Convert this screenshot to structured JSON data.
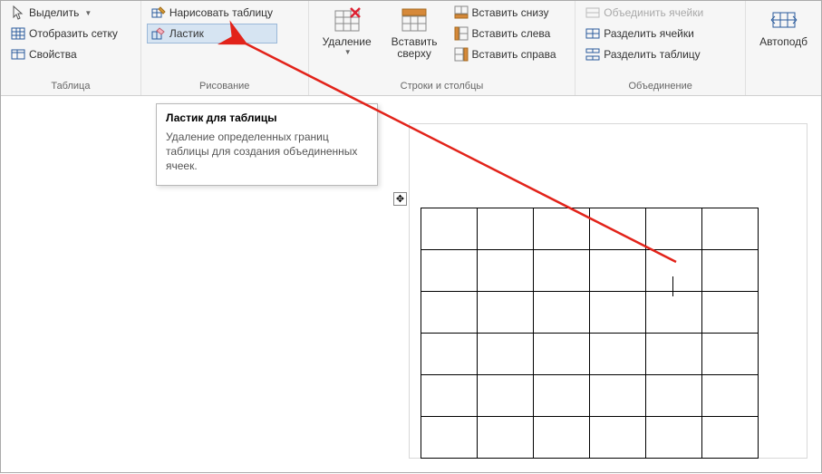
{
  "ribbon": {
    "table_group": {
      "label": "Таблица",
      "select": "Выделить",
      "showgrid": "Отобразить сетку",
      "properties": "Свойства"
    },
    "draw_group": {
      "label": "Рисование",
      "draw": "Нарисовать таблицу",
      "eraser": "Ластик"
    },
    "delete_group": {
      "delete": "Удаление"
    },
    "rows_group": {
      "label": "Строки и столбцы",
      "insert_top": "Вставить\nсверху",
      "insert_below": "Вставить снизу",
      "insert_left": "Вставить слева",
      "insert_right": "Вставить справа"
    },
    "merge_group": {
      "label": "Объединение",
      "merge": "Объединить ячейки",
      "split_cells": "Разделить ячейки",
      "split_table": "Разделить таблицу"
    },
    "autofit_group": {
      "autofit": "Автоподб"
    }
  },
  "tooltip": {
    "title": "Ластик для таблицы",
    "body": "Удаление определенных границ таблицы для создания объединенных ячеек."
  },
  "table": {
    "rows": 6,
    "cols": 6
  }
}
